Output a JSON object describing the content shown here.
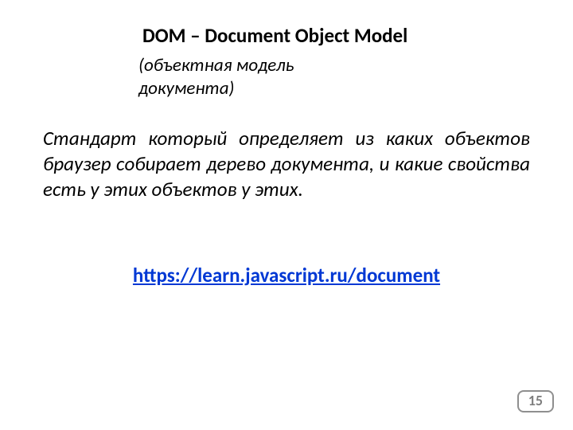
{
  "title": "DOM – Document Object Model",
  "subtitle": "(объектная модель документа)",
  "body": "Стандарт который определяет из каких объектов браузер собирает дерево документа, и какие свойства есть у этих объектов у этих.",
  "link": "https://learn.javascript.ru/document",
  "page_number": "15"
}
